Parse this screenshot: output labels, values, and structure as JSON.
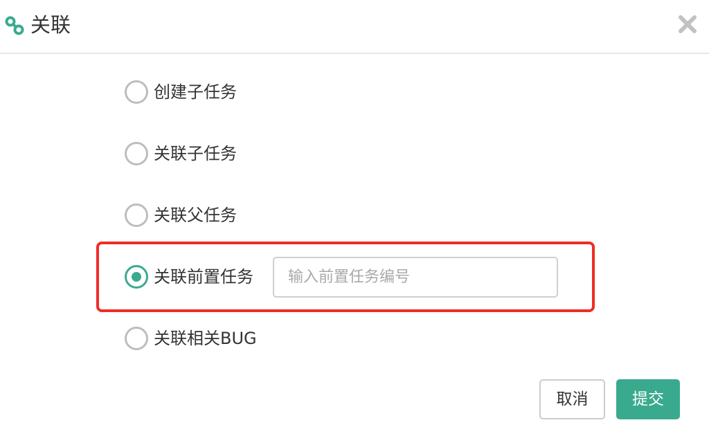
{
  "dialog": {
    "title": "关联",
    "title_icon": "link-icon",
    "close_icon": "close-icon"
  },
  "options": [
    {
      "label": "创建子任务",
      "checked": false
    },
    {
      "label": "关联子任务",
      "checked": false
    },
    {
      "label": "关联父任务",
      "checked": false
    },
    {
      "label": "关联前置任务",
      "checked": true
    },
    {
      "label": "关联相关BUG",
      "checked": false
    }
  ],
  "task_input": {
    "placeholder": "输入前置任务编号",
    "value": ""
  },
  "buttons": {
    "cancel_label": "取消",
    "submit_label": "提交"
  },
  "colors": {
    "accent": "#3aaa8e",
    "highlight": "#ee2d25",
    "border": "#cccccc"
  }
}
